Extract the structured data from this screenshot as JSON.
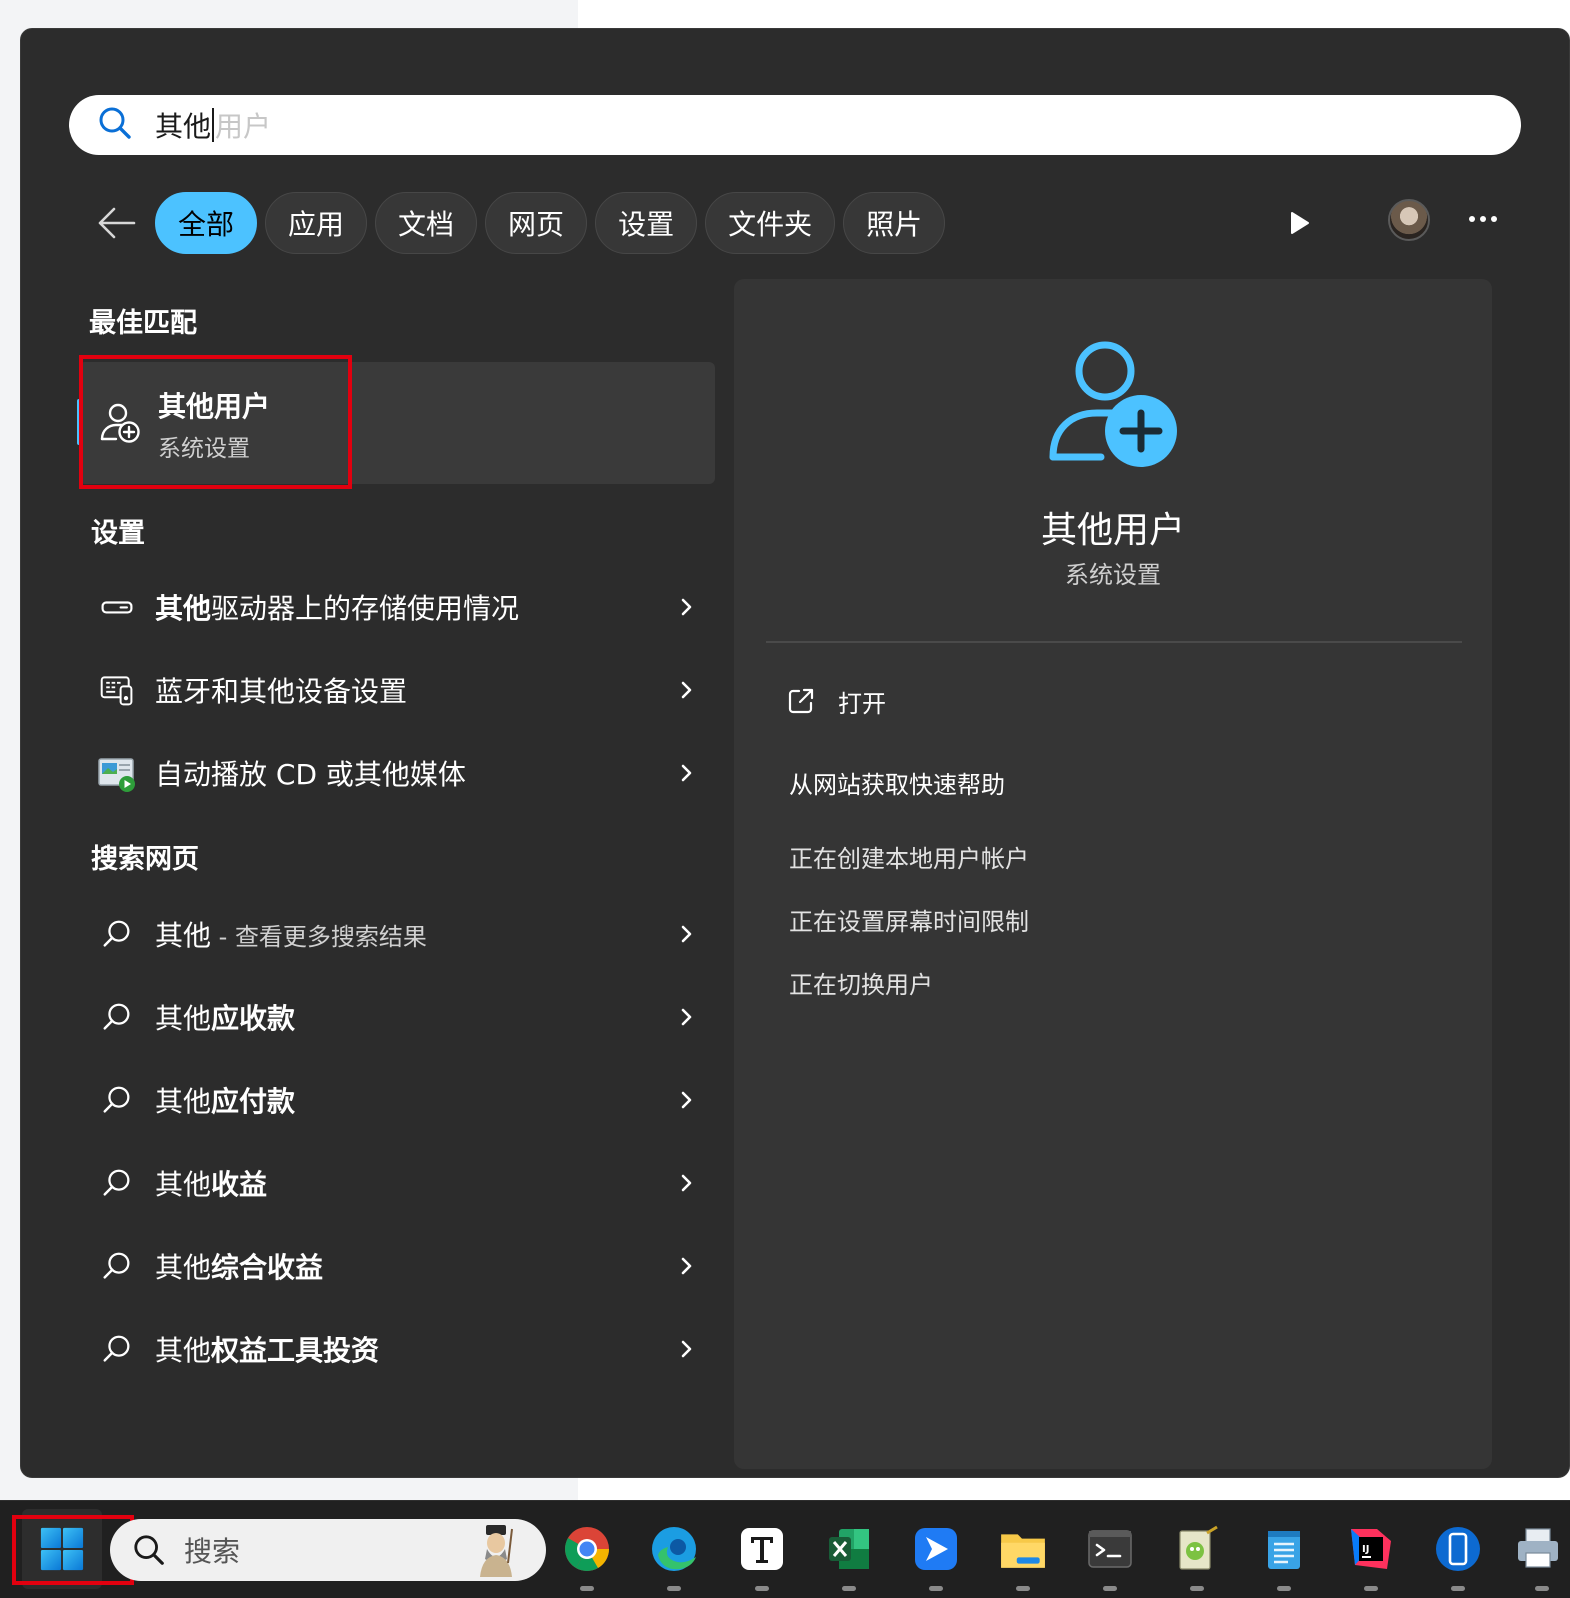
{
  "search": {
    "typed": "其他",
    "completion": "用户"
  },
  "filters": [
    "全部",
    "应用",
    "文档",
    "网页",
    "设置",
    "文件夹",
    "照片"
  ],
  "best_match": {
    "heading": "最佳匹配",
    "title": "其他用户",
    "subtitle": "系统设置",
    "icon": "add-user-icon"
  },
  "settings": {
    "heading": "设置",
    "items": [
      {
        "bold": "其他",
        "rest": "驱动器上的存储使用情况",
        "icon": "storage-icon"
      },
      {
        "bold": "",
        "rest": "蓝牙和其他设备设置",
        "icon": "devices-icon"
      },
      {
        "bold": "",
        "rest": "自动播放 CD 或其他媒体",
        "icon": "autoplay-icon"
      }
    ]
  },
  "web": {
    "heading": "搜索网页",
    "items": [
      {
        "lead": "其他",
        "sep": " - ",
        "rest": "查看更多搜索结果"
      },
      {
        "lead": "其他",
        "rest": "应收款"
      },
      {
        "lead": "其他",
        "rest": "应付款"
      },
      {
        "lead": "其他",
        "rest": "收益"
      },
      {
        "lead": "其他",
        "rest": "综合收益"
      },
      {
        "lead": "其他",
        "rest": "权益工具投资"
      }
    ]
  },
  "preview": {
    "title": "其他用户",
    "subtitle": "系统设置",
    "open_label": "打开",
    "help_heading": "从网站获取快速帮助",
    "help_links": [
      "正在创建本地用户帐户",
      "正在设置屏幕时间限制",
      "正在切换用户"
    ]
  },
  "taskbar": {
    "search_placeholder": "搜索",
    "apps": [
      "chrome-icon",
      "edge-icon",
      "typora-icon",
      "excel-icon",
      "feishu-icon",
      "file-explorer-icon",
      "terminal-icon",
      "notepadplusplus-icon",
      "notepad-icon",
      "intellij-idea-icon",
      "phone-link-icon",
      "printer-icon"
    ]
  },
  "colors": {
    "accent": "#4cc2ff",
    "highlight_box": "#e2000f",
    "panel_bg": "#2c2c2c"
  }
}
